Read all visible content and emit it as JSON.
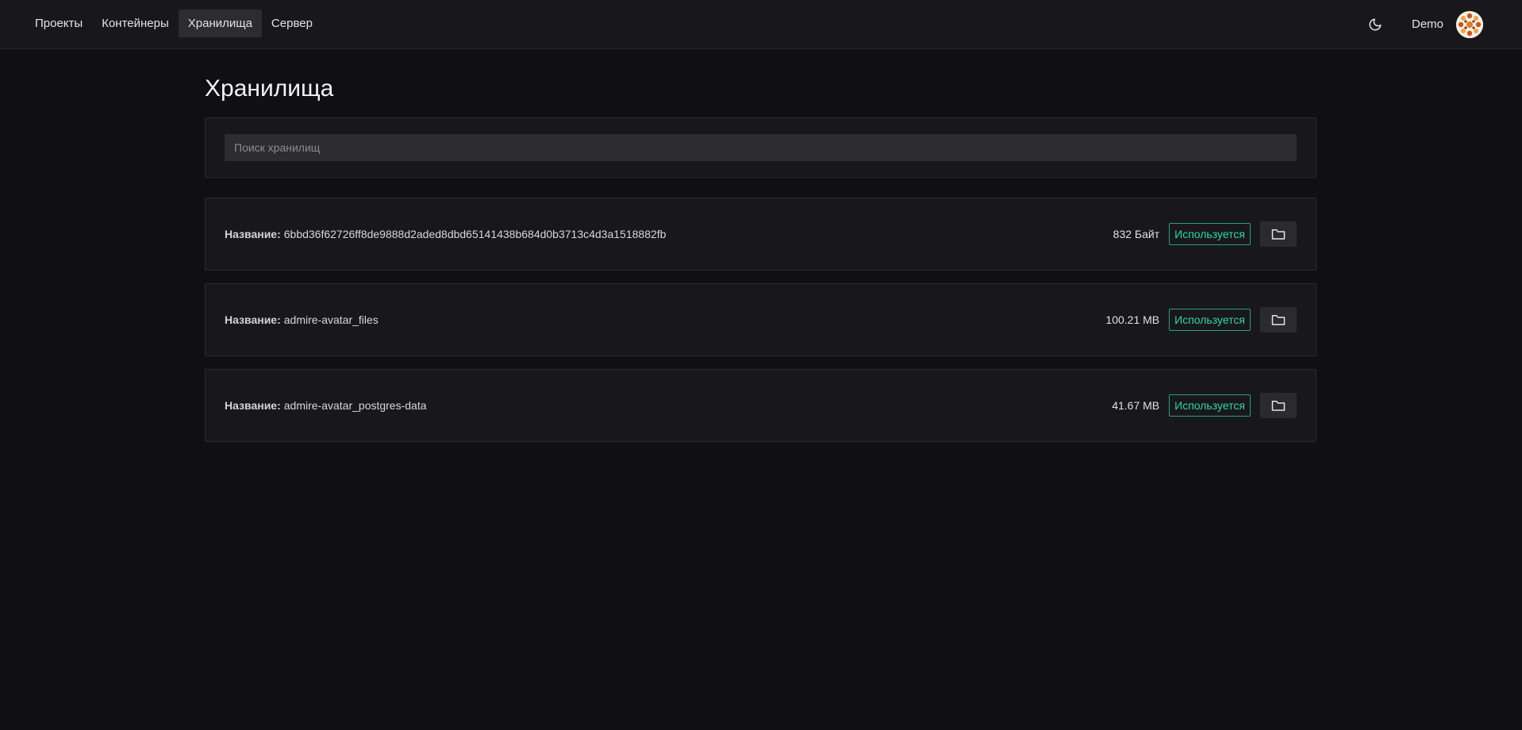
{
  "nav": {
    "items": [
      {
        "label": "Проекты",
        "active": false
      },
      {
        "label": "Контейнеры",
        "active": false
      },
      {
        "label": "Хранилища",
        "active": true
      },
      {
        "label": "Сервер",
        "active": false
      }
    ]
  },
  "user": {
    "name": "Demo",
    "theme_icon": "moon-icon"
  },
  "page": {
    "title": "Хранилища"
  },
  "search": {
    "placeholder": "Поиск хранилищ",
    "value": ""
  },
  "volumes": [
    {
      "label": "Название:",
      "name": "6bbd36f62726ff8de9888d2aded8dbd65141438b684d0b3713c4d3a1518882fb",
      "size": "832 Байт",
      "status": "Используется"
    },
    {
      "label": "Название:",
      "name": "admire-avatar_files",
      "size": "100.21 MB",
      "status": "Используется"
    },
    {
      "label": "Название:",
      "name": "admire-avatar_postgres-data",
      "size": "41.67 MB",
      "status": "Используется"
    }
  ],
  "colors": {
    "status": "#33d69f",
    "background": "#101014",
    "card": "#18181c"
  }
}
